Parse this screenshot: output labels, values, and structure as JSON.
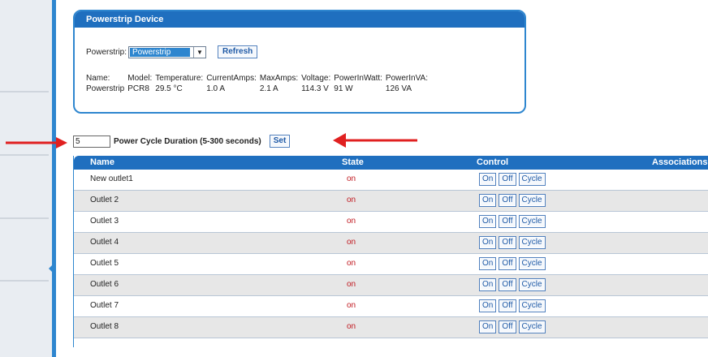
{
  "panel": {
    "title": "Powerstrip Device",
    "powerstrip_label": "Powerstrip:",
    "powerstrip_selected": "Powerstrip",
    "refresh_label": "Refresh",
    "info": [
      {
        "label": "Name:",
        "value": "Powerstrip"
      },
      {
        "label": "Model:",
        "value": "PCR8"
      },
      {
        "label": "Temperature:",
        "value": "29.5 °C"
      },
      {
        "label": "CurrentAmps:",
        "value": "1.0 A"
      },
      {
        "label": "MaxAmps:",
        "value": "2.1 A"
      },
      {
        "label": "Voltage:",
        "value": "114.3 V"
      },
      {
        "label": "PowerInWatt:",
        "value": "91 W"
      },
      {
        "label": "PowerInVA:",
        "value": "126 VA"
      }
    ]
  },
  "cycle": {
    "duration_value": "5",
    "label": "Power Cycle Duration (5-300 seconds)",
    "set_label": "Set"
  },
  "table": {
    "headers": {
      "name": "Name",
      "state": "State",
      "control": "Control",
      "associations": "Associations"
    },
    "button_labels": {
      "on": "On",
      "off": "Off",
      "cycle": "Cycle"
    },
    "rows": [
      {
        "name": "New outlet1",
        "state": "on"
      },
      {
        "name": "Outlet 2",
        "state": "on"
      },
      {
        "name": "Outlet 3",
        "state": "on"
      },
      {
        "name": "Outlet 4",
        "state": "on"
      },
      {
        "name": "Outlet 5",
        "state": "on"
      },
      {
        "name": "Outlet 6",
        "state": "on"
      },
      {
        "name": "Outlet 7",
        "state": "on"
      },
      {
        "name": "Outlet 8",
        "state": "on"
      }
    ]
  },
  "colors": {
    "header_blue": "#1f6fbf",
    "state_red": "#c0181f",
    "annotation_arrow": "#e02020"
  }
}
